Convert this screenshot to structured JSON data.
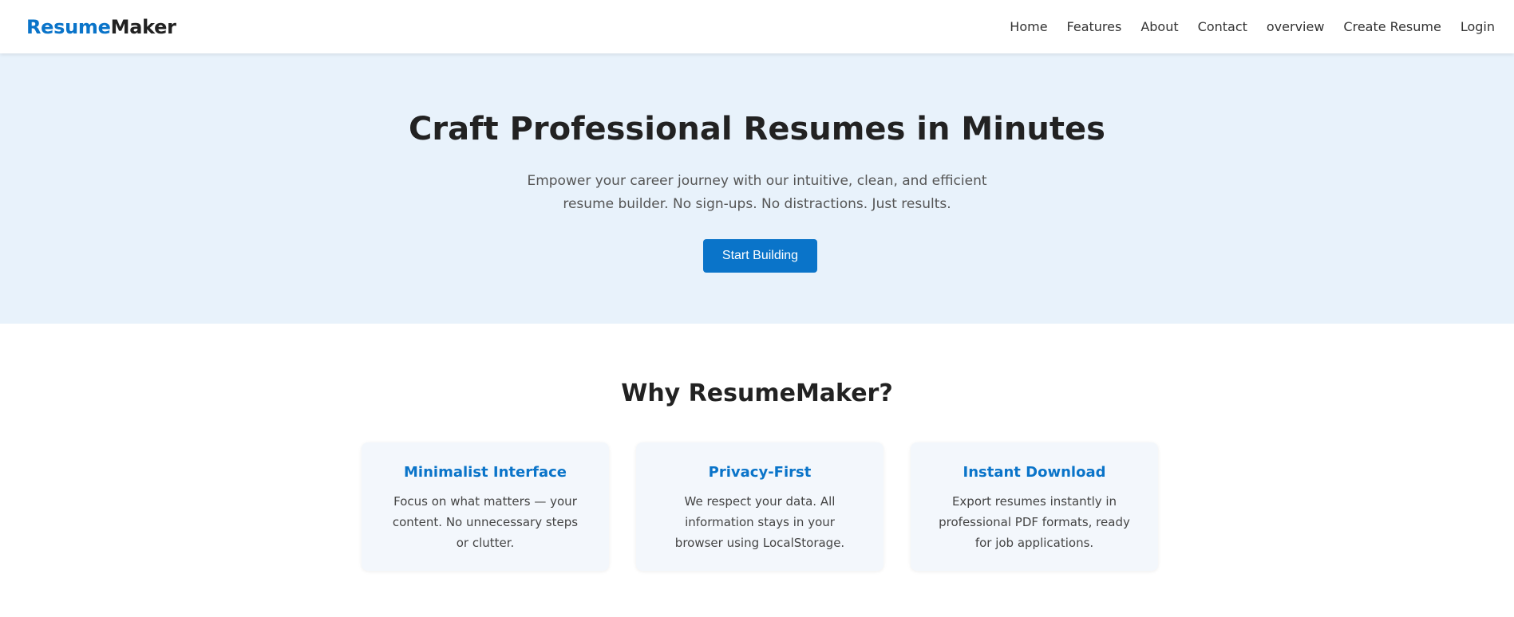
{
  "brand": {
    "accent": "Resume",
    "rest": "Maker",
    "accent_color": "#0a74c9"
  },
  "nav": {
    "items": [
      "Home",
      "Features",
      "About",
      "Contact",
      "overview",
      "Create Resume",
      "Login"
    ]
  },
  "hero": {
    "title": "Craft Professional Resumes in Minutes",
    "subtitle": "Empower your career journey with our intuitive, clean, and efficient resume builder. No sign-ups. No distractions. Just results.",
    "cta_label": "Start Building",
    "background_color": "#e8f2fb"
  },
  "features": {
    "title": "Why ResumeMaker?",
    "cards": [
      {
        "title": "Minimalist Interface",
        "text": "Focus on what matters — your content. No unnecessary steps or clutter."
      },
      {
        "title": "Privacy-First",
        "text": "We respect your data. All information stays in your browser using LocalStorage."
      },
      {
        "title": "Instant Download",
        "text": "Export resumes instantly in professional PDF formats, ready for job applications."
      }
    ]
  }
}
